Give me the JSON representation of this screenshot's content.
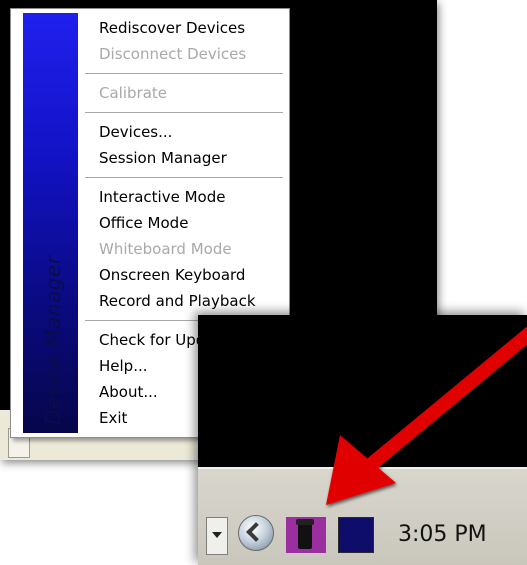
{
  "menu": {
    "side_label": "Device Manager",
    "groups": [
      [
        {
          "label": "Rediscover Devices",
          "enabled": true
        },
        {
          "label": "Disconnect Devices",
          "enabled": false
        }
      ],
      [
        {
          "label": "Calibrate",
          "enabled": false
        }
      ],
      [
        {
          "label": "Devices...",
          "enabled": true
        },
        {
          "label": "Session Manager",
          "enabled": true
        }
      ],
      [
        {
          "label": "Interactive Mode",
          "enabled": true
        },
        {
          "label": "Office Mode",
          "enabled": true
        },
        {
          "label": "Whiteboard Mode",
          "enabled": false
        },
        {
          "label": "Onscreen Keyboard",
          "enabled": true
        },
        {
          "label": "Record and Playback",
          "enabled": true
        }
      ],
      [
        {
          "label": "Check for Upda",
          "enabled": true
        },
        {
          "label": "Help...",
          "enabled": true
        },
        {
          "label": "About...",
          "enabled": true
        },
        {
          "label": "Exit",
          "enabled": true
        }
      ]
    ]
  },
  "taskbar": {
    "clock": "3:05 PM",
    "icons": {
      "collapse": "chevron-left-icon",
      "device_manager": "device-manager-tray-icon",
      "other": "blue-tray-icon"
    }
  },
  "colors": {
    "menu_band_top": "#2020ee",
    "menu_band_bottom": "#06064a",
    "disabled_text": "#a9a9a9",
    "arrow": "#e00000",
    "tray_icon_active": "#9b2fa0"
  }
}
